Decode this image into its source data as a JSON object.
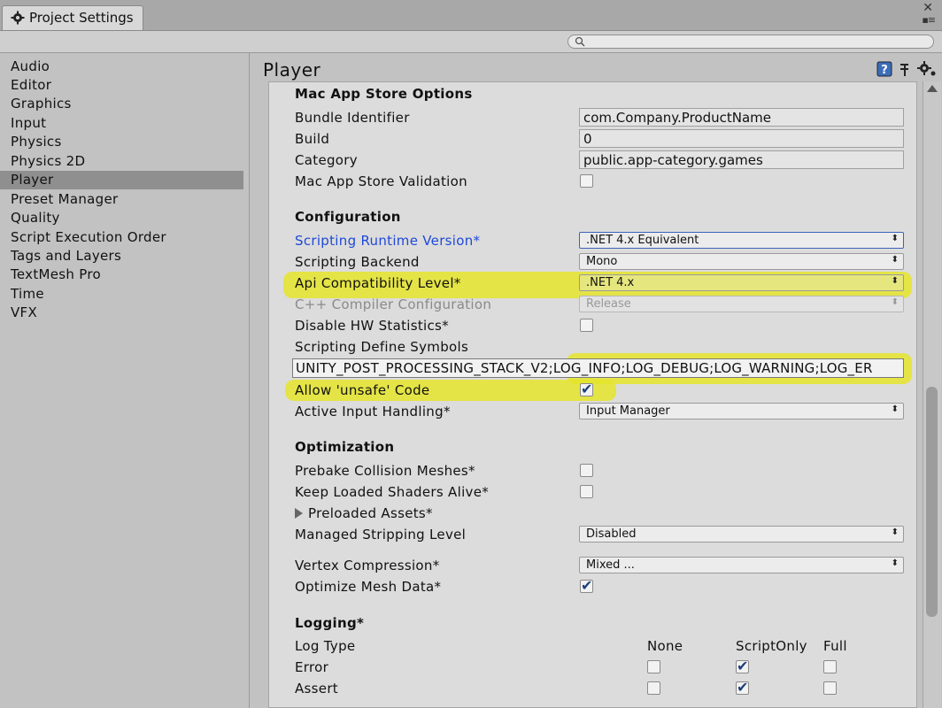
{
  "window": {
    "tab_title": "Project Settings"
  },
  "search": {
    "placeholder": ""
  },
  "nav": {
    "items": [
      "Audio",
      "Editor",
      "Graphics",
      "Input",
      "Physics",
      "Physics 2D",
      "Player",
      "Preset Manager",
      "Quality",
      "Script Execution Order",
      "Tags and Layers",
      "TextMesh Pro",
      "Time",
      "VFX"
    ],
    "selected": "Player"
  },
  "page": {
    "title": "Player"
  },
  "mac_app_store": {
    "header": "Mac App Store Options",
    "bundle_identifier_label": "Bundle Identifier",
    "bundle_identifier_value": "com.Company.ProductName",
    "build_label": "Build",
    "build_value": "0",
    "category_label": "Category",
    "category_value": "public.app-category.games",
    "validation_label": "Mac App Store Validation",
    "validation_checked": false
  },
  "configuration": {
    "header": "Configuration",
    "runtime_label": "Scripting Runtime Version*",
    "runtime_value": ".NET 4.x Equivalent",
    "backend_label": "Scripting Backend",
    "backend_value": "Mono",
    "api_label": "Api Compatibility Level*",
    "api_value": ".NET 4.x",
    "cpp_label": "C++ Compiler Configuration",
    "cpp_value": "Release",
    "hw_stats_label": "Disable HW Statistics*",
    "hw_stats_checked": false,
    "define_label": "Scripting Define Symbols",
    "define_value": "UNITY_POST_PROCESSING_STACK_V2;LOG_INFO;LOG_DEBUG;LOG_WARNING;LOG_ER",
    "unsafe_label": "Allow 'unsafe' Code",
    "unsafe_checked": true,
    "input_label": "Active Input Handling*",
    "input_value": "Input Manager"
  },
  "optimization": {
    "header": "Optimization",
    "prebake_label": "Prebake Collision Meshes*",
    "prebake_checked": false,
    "shaders_label": "Keep Loaded Shaders Alive*",
    "shaders_checked": false,
    "preloaded_label": "Preloaded Assets*",
    "stripping_label": "Managed Stripping Level",
    "stripping_value": "Disabled",
    "vertex_label": "Vertex Compression*",
    "vertex_value": "Mixed ...",
    "optimize_mesh_label": "Optimize Mesh Data*",
    "optimize_mesh_checked": true
  },
  "logging": {
    "header": "Logging*",
    "log_type_label": "Log Type",
    "col_none": "None",
    "col_scriptonly": "ScriptOnly",
    "col_full": "Full",
    "rows": [
      {
        "label": "Error",
        "selected": "ScriptOnly"
      },
      {
        "label": "Assert",
        "selected": "ScriptOnly"
      }
    ]
  },
  "colors": {
    "highlight": "#e5e52c",
    "link_blue": "#1e49d8",
    "selected_nav": "#8f8f8f"
  }
}
